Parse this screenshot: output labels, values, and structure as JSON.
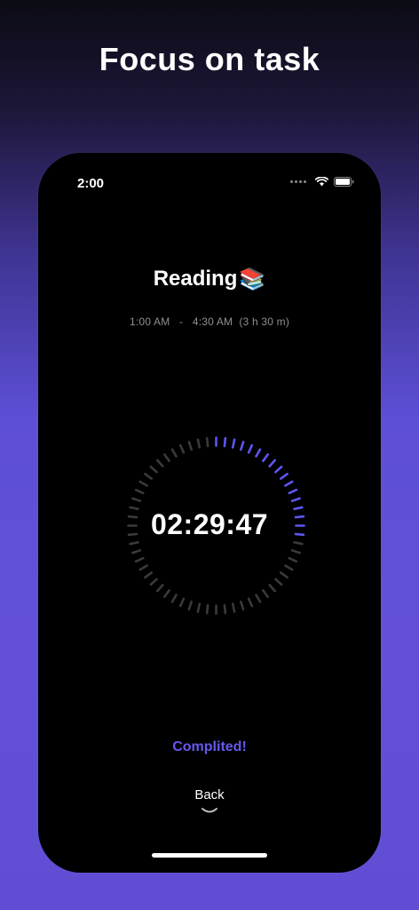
{
  "promo": {
    "headline": "Focus on task"
  },
  "status_bar": {
    "time": "2:00",
    "icons": [
      "signal-dots-icon",
      "wifi-icon",
      "battery-icon"
    ]
  },
  "task": {
    "title": "Reading",
    "emoji": "📚",
    "start_time": "1:00 AM",
    "separator": "-",
    "end_time": "4:30 AM",
    "duration": "(3 h 30 m)"
  },
  "timer": {
    "value": "02:29:47",
    "progress_fraction": 0.29,
    "total_ticks": 60,
    "accent_color": "#5d56f0",
    "inactive_color": "#3a3a3a"
  },
  "status_message": "Complited!",
  "navigation": {
    "back_label": "Back",
    "chevron_icon": "chevron-down-icon"
  }
}
